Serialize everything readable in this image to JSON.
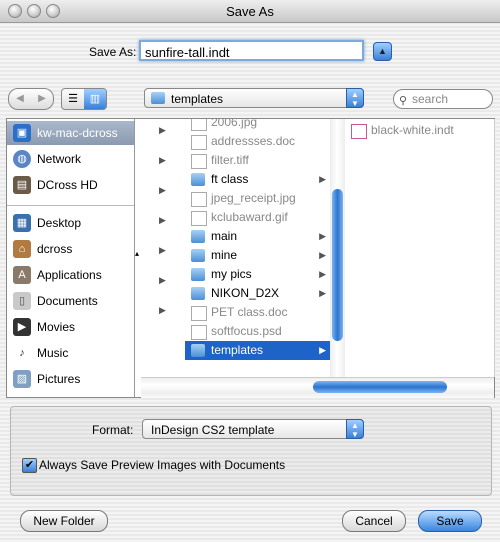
{
  "window": {
    "title": "Save As"
  },
  "save": {
    "label": "Save As:",
    "filename": "sunfire-tall.indt"
  },
  "toolbar": {
    "location": "templates",
    "search_placeholder": "search"
  },
  "sidebar": {
    "devices": [
      {
        "label": "kw-mac-dcross",
        "icon": "computer-icon",
        "selected": true
      },
      {
        "label": "Network",
        "icon": "network-globe-icon"
      },
      {
        "label": "DCross HD",
        "icon": "hard-drive-icon"
      }
    ],
    "places": [
      {
        "label": "Desktop",
        "icon": "desktop-icon"
      },
      {
        "label": "dcross",
        "icon": "home-icon"
      },
      {
        "label": "Applications",
        "icon": "applications-icon"
      },
      {
        "label": "Documents",
        "icon": "documents-icon"
      },
      {
        "label": "Movies",
        "icon": "movies-icon"
      },
      {
        "label": "Music",
        "icon": "music-icon"
      },
      {
        "label": "Pictures",
        "icon": "pictures-icon"
      }
    ]
  },
  "column2": [
    {
      "label": "2006.jpg",
      "kind": "file",
      "dim": true
    },
    {
      "label": "addressses.doc",
      "kind": "file",
      "dim": true
    },
    {
      "label": "filter.tiff",
      "kind": "file",
      "dim": true
    },
    {
      "label": "ft class",
      "kind": "folder"
    },
    {
      "label": "jpeg_receipt.jpg",
      "kind": "file",
      "dim": true
    },
    {
      "label": "kclubaward.gif",
      "kind": "file",
      "dim": true
    },
    {
      "label": "main",
      "kind": "folder"
    },
    {
      "label": "mine",
      "kind": "folder"
    },
    {
      "label": "my pics",
      "kind": "folder"
    },
    {
      "label": "NIKON_D2X",
      "kind": "folder"
    },
    {
      "label": "PET class.doc",
      "kind": "file",
      "dim": true
    },
    {
      "label": "softfocus.psd",
      "kind": "file",
      "dim": true
    },
    {
      "label": "templates",
      "kind": "folder",
      "selected": true
    }
  ],
  "column3": [
    {
      "label": "black-white.indt",
      "kind": "file",
      "dim": true
    }
  ],
  "options": {
    "format_label": "Format:",
    "format_value": "InDesign CS2 template",
    "preview_checkbox_label": "Always Save Preview Images with Documents",
    "preview_checked": true
  },
  "buttons": {
    "new_folder": "New Folder",
    "cancel": "Cancel",
    "save": "Save"
  }
}
